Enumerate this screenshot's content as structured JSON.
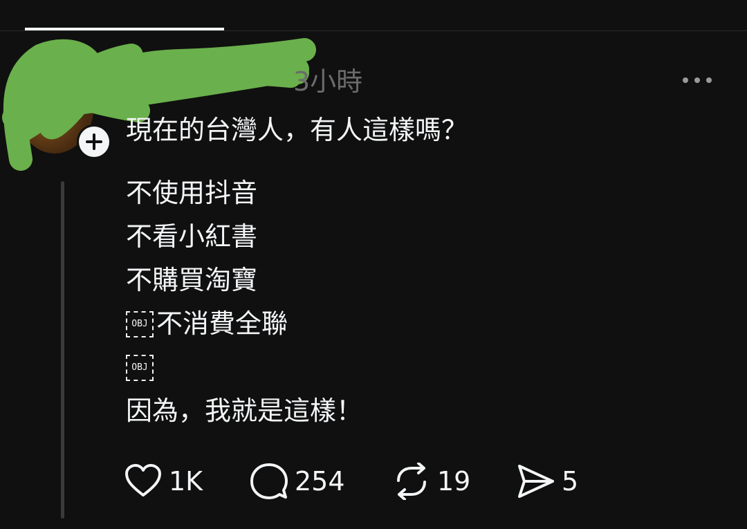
{
  "post": {
    "timestamp": "3小時",
    "title": "現在的台灣人，有人這樣嗎？",
    "lines": [
      {
        "obj": "",
        "text": "不使用抖音"
      },
      {
        "obj": "",
        "text": "不看小紅書"
      },
      {
        "obj": "",
        "text": "不購買淘寶"
      },
      {
        "obj": "OBJ",
        "text": "不消費全聯"
      },
      {
        "obj": "OBJ",
        "text": ""
      },
      {
        "obj": "",
        "text": "因為，我就是這樣！"
      }
    ]
  },
  "actions": {
    "like_count": "1K",
    "reply_count": "254",
    "repost_count": "19",
    "share_count": "5"
  },
  "icons": {
    "like": "heart-icon",
    "reply": "comment-bubble-icon",
    "repost": "repost-arrows-icon",
    "share": "send-arrow-icon",
    "more": "more-dots-icon",
    "follow": "plus-icon"
  },
  "colors": {
    "background": "#101010",
    "text": "#f3f5f7",
    "muted": "#6b6b6b",
    "redaction": "#6ab04c"
  }
}
